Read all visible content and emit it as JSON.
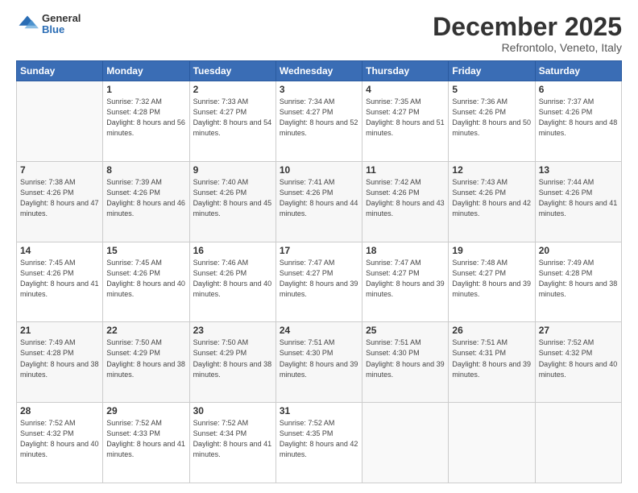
{
  "logo": {
    "general": "General",
    "blue": "Blue"
  },
  "header": {
    "month": "December 2025",
    "location": "Refrontolo, Veneto, Italy"
  },
  "weekdays": [
    "Sunday",
    "Monday",
    "Tuesday",
    "Wednesday",
    "Thursday",
    "Friday",
    "Saturday"
  ],
  "weeks": [
    [
      {
        "day": "",
        "sunrise": "",
        "sunset": "",
        "daylight": ""
      },
      {
        "day": "1",
        "sunrise": "Sunrise: 7:32 AM",
        "sunset": "Sunset: 4:28 PM",
        "daylight": "Daylight: 8 hours and 56 minutes."
      },
      {
        "day": "2",
        "sunrise": "Sunrise: 7:33 AM",
        "sunset": "Sunset: 4:27 PM",
        "daylight": "Daylight: 8 hours and 54 minutes."
      },
      {
        "day": "3",
        "sunrise": "Sunrise: 7:34 AM",
        "sunset": "Sunset: 4:27 PM",
        "daylight": "Daylight: 8 hours and 52 minutes."
      },
      {
        "day": "4",
        "sunrise": "Sunrise: 7:35 AM",
        "sunset": "Sunset: 4:27 PM",
        "daylight": "Daylight: 8 hours and 51 minutes."
      },
      {
        "day": "5",
        "sunrise": "Sunrise: 7:36 AM",
        "sunset": "Sunset: 4:26 PM",
        "daylight": "Daylight: 8 hours and 50 minutes."
      },
      {
        "day": "6",
        "sunrise": "Sunrise: 7:37 AM",
        "sunset": "Sunset: 4:26 PM",
        "daylight": "Daylight: 8 hours and 48 minutes."
      }
    ],
    [
      {
        "day": "7",
        "sunrise": "Sunrise: 7:38 AM",
        "sunset": "Sunset: 4:26 PM",
        "daylight": "Daylight: 8 hours and 47 minutes."
      },
      {
        "day": "8",
        "sunrise": "Sunrise: 7:39 AM",
        "sunset": "Sunset: 4:26 PM",
        "daylight": "Daylight: 8 hours and 46 minutes."
      },
      {
        "day": "9",
        "sunrise": "Sunrise: 7:40 AM",
        "sunset": "Sunset: 4:26 PM",
        "daylight": "Daylight: 8 hours and 45 minutes."
      },
      {
        "day": "10",
        "sunrise": "Sunrise: 7:41 AM",
        "sunset": "Sunset: 4:26 PM",
        "daylight": "Daylight: 8 hours and 44 minutes."
      },
      {
        "day": "11",
        "sunrise": "Sunrise: 7:42 AM",
        "sunset": "Sunset: 4:26 PM",
        "daylight": "Daylight: 8 hours and 43 minutes."
      },
      {
        "day": "12",
        "sunrise": "Sunrise: 7:43 AM",
        "sunset": "Sunset: 4:26 PM",
        "daylight": "Daylight: 8 hours and 42 minutes."
      },
      {
        "day": "13",
        "sunrise": "Sunrise: 7:44 AM",
        "sunset": "Sunset: 4:26 PM",
        "daylight": "Daylight: 8 hours and 41 minutes."
      }
    ],
    [
      {
        "day": "14",
        "sunrise": "Sunrise: 7:45 AM",
        "sunset": "Sunset: 4:26 PM",
        "daylight": "Daylight: 8 hours and 41 minutes."
      },
      {
        "day": "15",
        "sunrise": "Sunrise: 7:45 AM",
        "sunset": "Sunset: 4:26 PM",
        "daylight": "Daylight: 8 hours and 40 minutes."
      },
      {
        "day": "16",
        "sunrise": "Sunrise: 7:46 AM",
        "sunset": "Sunset: 4:26 PM",
        "daylight": "Daylight: 8 hours and 40 minutes."
      },
      {
        "day": "17",
        "sunrise": "Sunrise: 7:47 AM",
        "sunset": "Sunset: 4:27 PM",
        "daylight": "Daylight: 8 hours and 39 minutes."
      },
      {
        "day": "18",
        "sunrise": "Sunrise: 7:47 AM",
        "sunset": "Sunset: 4:27 PM",
        "daylight": "Daylight: 8 hours and 39 minutes."
      },
      {
        "day": "19",
        "sunrise": "Sunrise: 7:48 AM",
        "sunset": "Sunset: 4:27 PM",
        "daylight": "Daylight: 8 hours and 39 minutes."
      },
      {
        "day": "20",
        "sunrise": "Sunrise: 7:49 AM",
        "sunset": "Sunset: 4:28 PM",
        "daylight": "Daylight: 8 hours and 38 minutes."
      }
    ],
    [
      {
        "day": "21",
        "sunrise": "Sunrise: 7:49 AM",
        "sunset": "Sunset: 4:28 PM",
        "daylight": "Daylight: 8 hours and 38 minutes."
      },
      {
        "day": "22",
        "sunrise": "Sunrise: 7:50 AM",
        "sunset": "Sunset: 4:29 PM",
        "daylight": "Daylight: 8 hours and 38 minutes."
      },
      {
        "day": "23",
        "sunrise": "Sunrise: 7:50 AM",
        "sunset": "Sunset: 4:29 PM",
        "daylight": "Daylight: 8 hours and 38 minutes."
      },
      {
        "day": "24",
        "sunrise": "Sunrise: 7:51 AM",
        "sunset": "Sunset: 4:30 PM",
        "daylight": "Daylight: 8 hours and 39 minutes."
      },
      {
        "day": "25",
        "sunrise": "Sunrise: 7:51 AM",
        "sunset": "Sunset: 4:30 PM",
        "daylight": "Daylight: 8 hours and 39 minutes."
      },
      {
        "day": "26",
        "sunrise": "Sunrise: 7:51 AM",
        "sunset": "Sunset: 4:31 PM",
        "daylight": "Daylight: 8 hours and 39 minutes."
      },
      {
        "day": "27",
        "sunrise": "Sunrise: 7:52 AM",
        "sunset": "Sunset: 4:32 PM",
        "daylight": "Daylight: 8 hours and 40 minutes."
      }
    ],
    [
      {
        "day": "28",
        "sunrise": "Sunrise: 7:52 AM",
        "sunset": "Sunset: 4:32 PM",
        "daylight": "Daylight: 8 hours and 40 minutes."
      },
      {
        "day": "29",
        "sunrise": "Sunrise: 7:52 AM",
        "sunset": "Sunset: 4:33 PM",
        "daylight": "Daylight: 8 hours and 41 minutes."
      },
      {
        "day": "30",
        "sunrise": "Sunrise: 7:52 AM",
        "sunset": "Sunset: 4:34 PM",
        "daylight": "Daylight: 8 hours and 41 minutes."
      },
      {
        "day": "31",
        "sunrise": "Sunrise: 7:52 AM",
        "sunset": "Sunset: 4:35 PM",
        "daylight": "Daylight: 8 hours and 42 minutes."
      },
      {
        "day": "",
        "sunrise": "",
        "sunset": "",
        "daylight": ""
      },
      {
        "day": "",
        "sunrise": "",
        "sunset": "",
        "daylight": ""
      },
      {
        "day": "",
        "sunrise": "",
        "sunset": "",
        "daylight": ""
      }
    ]
  ]
}
